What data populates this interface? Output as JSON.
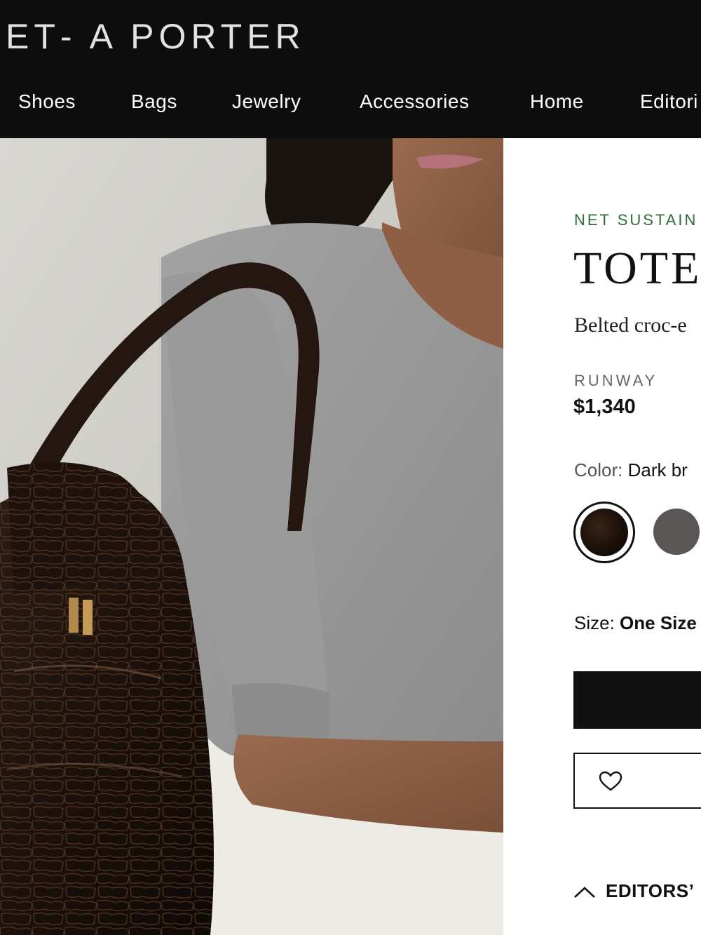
{
  "brand": {
    "logo_text": "ET‑ A  PORTER"
  },
  "nav": {
    "items": [
      {
        "label": "Shoes"
      },
      {
        "label": "Bags"
      },
      {
        "label": "Jewelry"
      },
      {
        "label": "Accessories"
      },
      {
        "label": "Home"
      },
      {
        "label": "Editori"
      }
    ]
  },
  "product": {
    "eyebrow": "NET SUSTAIN",
    "title": "TOTE",
    "subtitle": "Belted croc-e",
    "runway_label": "RUNWAY",
    "price": "$1,340",
    "color_label": "Color:",
    "color_value": "Dark br",
    "size_label": "Size:",
    "size_value": "One Size",
    "editors_label": "EDITORS’"
  },
  "colors": {
    "header_bg": "#0d0d0d",
    "eyebrow_green": "#2f6b3b",
    "swatch_selected": "#1a0f09",
    "swatch_alt": "#5a5656"
  },
  "icons": {
    "wishlist": "heart-icon",
    "editors_toggle": "chevron-up-icon"
  }
}
